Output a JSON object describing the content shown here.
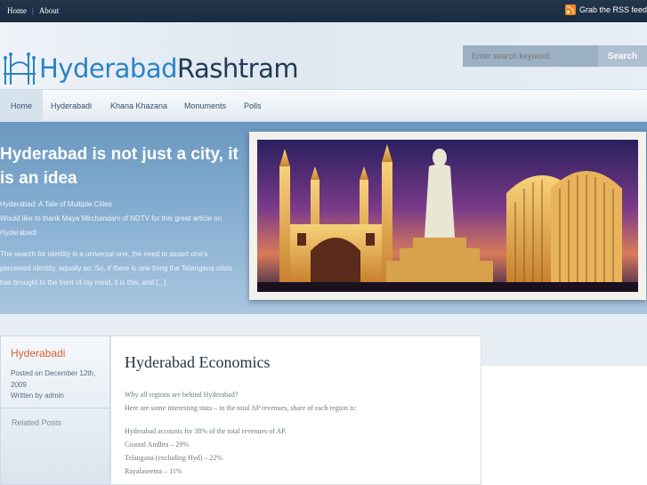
{
  "topbar": {
    "links": [
      {
        "label": "Home"
      },
      {
        "label": "About"
      }
    ],
    "rss_label": "Grab the RSS feed"
  },
  "logo": {
    "part1": "Hyderabad",
    "part2": "Rashtram"
  },
  "search": {
    "placeholder": "Enter search keyword",
    "button_label": "Search"
  },
  "nav": {
    "items": [
      {
        "label": "Home",
        "active": true
      },
      {
        "label": "Hyderabadi"
      },
      {
        "label": "Khana Khazana"
      },
      {
        "label": "Monuments"
      },
      {
        "label": "Polls"
      }
    ]
  },
  "featured": {
    "title": "Hyderabad is not just a city, it is an idea",
    "line1": "Hyderabad: A Tale of Multiple Cities",
    "line2": "Would like to thank Maya Mirchandani of NDTV for this great article on Hyderabad!",
    "para2": "The search for identity is a universal one, the need to assert one’s perceived identity, equally so. So, if there is one thing the Telangana crisis has brought to the front of my mind, it is this, and [...]"
  },
  "sidebar": {
    "category": "Hyderabadi",
    "posted_on": "Posted on December 12th, 2009",
    "written_by": "Written by admin",
    "related_title": "Related Posts"
  },
  "post": {
    "title": "Hyderabad Economics",
    "intro1": "Why all regions are behind Hyderabad?",
    "intro2": "Here are some interesting stats – in the total AP revenues, share of each region is:",
    "stat1": "Hyderabad accounts for 38% of the total revenues of AP.",
    "stat2": "Coastal Andhra – 29%",
    "stat3": "Telangana (excluding Hyd) – 22%",
    "stat4": "Rayalaseema – 11%"
  },
  "colors": {
    "accent": "#2a83c5",
    "dark": "#223a55",
    "category": "#d8602a",
    "rss": "#f08a24"
  }
}
